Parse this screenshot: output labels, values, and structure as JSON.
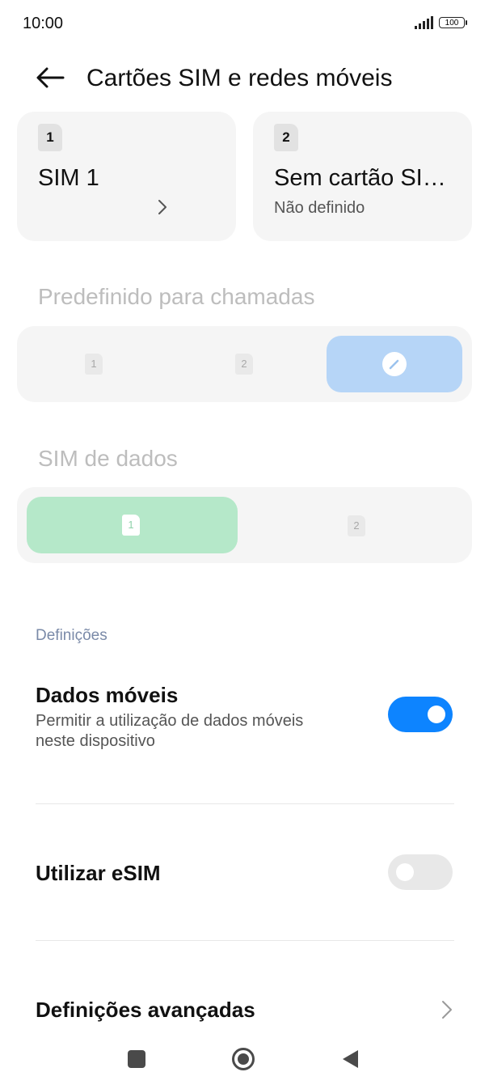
{
  "status_bar": {
    "time": "10:00",
    "battery": "100"
  },
  "header": {
    "title": "Cartões SIM e redes móveis"
  },
  "sim_cards": [
    {
      "slot": "1",
      "name": "SIM 1",
      "status": ""
    },
    {
      "slot": "2",
      "name": "Sem cartão SI…",
      "status": "Não definido"
    }
  ],
  "calls": {
    "title": "Predefinido para chamadas",
    "options": [
      "1",
      "2"
    ]
  },
  "data_sim": {
    "title": "SIM de dados",
    "options": [
      "1",
      "2"
    ]
  },
  "settings": {
    "section_label": "Definições",
    "mobile_data": {
      "title": "Dados móveis",
      "subtitle_line1": "Permitir a utilização de dados móveis",
      "subtitle_line2": "neste dispositivo",
      "enabled": true
    },
    "esim": {
      "title": "Utilizar eSIM",
      "enabled": false
    },
    "advanced": {
      "title": "Definições avançadas"
    }
  },
  "colors": {
    "accent": "#0d84ff",
    "calls_selected": "#b6d5f7",
    "data_selected": "#b5e8c9"
  },
  "icons": {
    "back": "arrow-left-icon",
    "signal": "signal-bars-icon",
    "battery": "battery-icon",
    "chevron": "chevron-right-icon",
    "nav_recents": "square-icon",
    "nav_home": "circle-icon",
    "nav_back": "triangle-left-icon"
  }
}
